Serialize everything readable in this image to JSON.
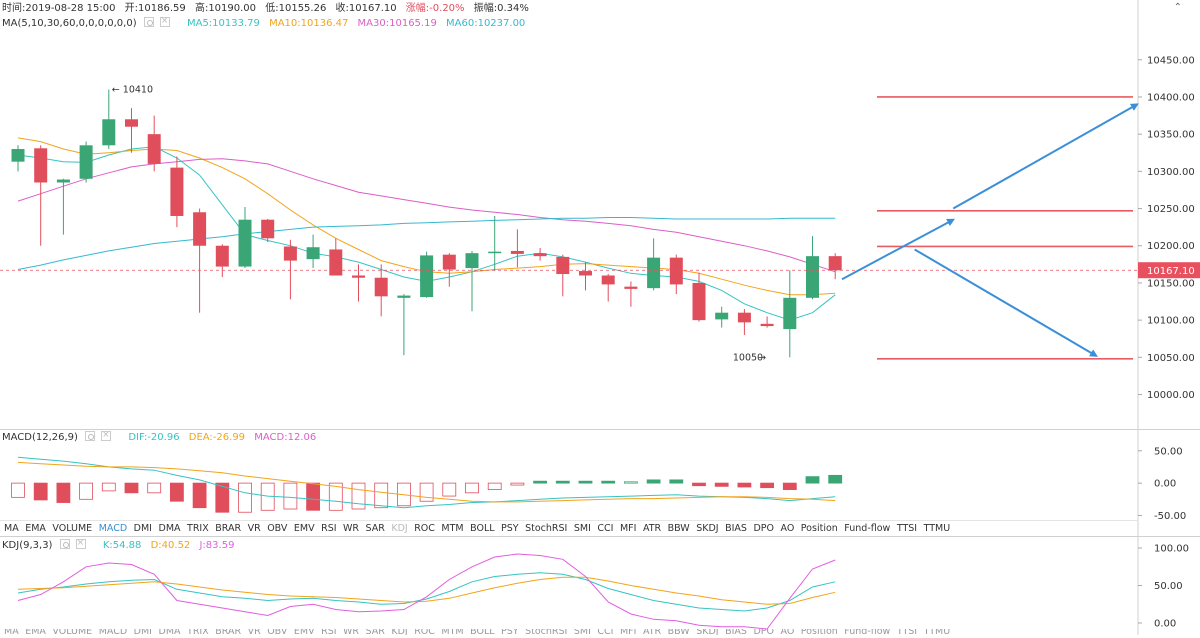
{
  "header": {
    "time": "时间:2019-08-28 15:00",
    "open": "开:10186.59",
    "high": "高:10190.00",
    "low": "低:10155.26",
    "close": "收:10167.10",
    "change": "涨幅:-0.20%",
    "amplitude": "振幅:0.34%"
  },
  "ma_header": {
    "label": "MA(5,10,30,60,0,0,0,0,0,0)",
    "ma5": "MA5:10133.79",
    "ma10": "MA10:10136.47",
    "ma30": "MA30:10165.19",
    "ma60": "MA60:10237.00"
  },
  "macd_header": {
    "label": "MACD(12,26,9)",
    "dif": "DIF:-20.96",
    "dea": "DEA:-26.99",
    "macd": "MACD:12.06"
  },
  "kdj_header": {
    "label": "KDJ(9,3,3)",
    "k": "K:54.88",
    "d": "D:40.52",
    "j": "J:83.59"
  },
  "indicator_tabs": [
    "MA",
    "EMA",
    "VOLUME",
    "MACD",
    "DMI",
    "DMA",
    "TRIX",
    "BRAR",
    "VR",
    "OBV",
    "EMV",
    "RSI",
    "WR",
    "SAR",
    "KDJ",
    "ROC",
    "MTM",
    "BOLL",
    "PSY",
    "StochRSI",
    "SMI",
    "CCI",
    "MFI",
    "ATR",
    "BBW",
    "SKDJ",
    "BIAS",
    "DPO",
    "AO",
    "Position",
    "Fund-flow",
    "TTSI",
    "TTMU"
  ],
  "indicator_tabs_dimmed": [
    "MA",
    "EMA",
    "VOLUME",
    "MACD",
    "DMI",
    "DMA",
    "TRIX",
    "BRAR",
    "VR",
    "OBV",
    "EMV",
    "RSI",
    "WR",
    "SAR",
    "KDJ",
    "ROC",
    "MTM",
    "BOLL",
    "PSY",
    "StochRSI",
    "SMI",
    "CCI",
    "MFI",
    "ATR",
    "BBW",
    "SKDJ",
    "BIAS",
    "DPO",
    "AO",
    "Position",
    "Fund-flow",
    "TTSI",
    "TTMU"
  ],
  "active_tab": "MACD",
  "disabled_tab": "KDJ",
  "colors": {
    "up": "#3aa575",
    "down": "#e04e5c",
    "ma5": "#36c3c4",
    "ma10": "#f2a41b",
    "ma30": "#dc5ec8",
    "ma60": "#36b9cf",
    "dif": "#36c3c4",
    "dea": "#f2a41b",
    "macd": "#dc5ec8",
    "k": "#36c3c4",
    "d": "#f2a41b",
    "j": "#e15ee0",
    "arrow": "#3b8fd8",
    "level": "#e85b62",
    "price_tag": "#e8505f"
  },
  "chart_data": [
    {
      "type": "candlestick",
      "title": "",
      "y_axis_ticks": [
        "10450.00",
        "10400.00",
        "10350.00",
        "10300.00",
        "10250.00",
        "10200.00",
        "10150.00",
        "10100.00",
        "10050.00",
        "10000.00"
      ],
      "tick_values": [
        10450,
        10400,
        10350,
        10300,
        10250,
        10200,
        10150,
        10100,
        10050,
        10000
      ],
      "ylim": [
        9955,
        10490
      ],
      "last_price_label": "10167.10",
      "last_price": 10167.1,
      "annotations": [
        {
          "text": "10410",
          "value": 10410,
          "candle_index": 4
        },
        {
          "text": "10050",
          "value": 10050,
          "candle_index": 33
        }
      ],
      "horizontal_levels": [
        10400,
        10247,
        10199,
        10048
      ],
      "trend_arrows": [
        {
          "from_candle": 36.3,
          "from_value": 10155,
          "to_candle": 41.2,
          "to_value": 10235
        },
        {
          "from_candle": 41.2,
          "from_value": 10250,
          "to_candle": 49.3,
          "to_value": 10390
        },
        {
          "from_candle": 39.5,
          "from_value": 10195,
          "to_candle": 47.5,
          "to_value": 10052
        }
      ],
      "candles": [
        {
          "o": 10313,
          "h": 10335,
          "l": 10300,
          "c": 10330
        },
        {
          "o": 10331,
          "h": 10335,
          "l": 10200,
          "c": 10285
        },
        {
          "o": 10285,
          "h": 10290,
          "l": 10215,
          "c": 10289
        },
        {
          "o": 10290,
          "h": 10340,
          "l": 10285,
          "c": 10335
        },
        {
          "o": 10335,
          "h": 10410,
          "l": 10330,
          "c": 10370
        },
        {
          "o": 10370,
          "h": 10385,
          "l": 10325,
          "c": 10360
        },
        {
          "o": 10350,
          "h": 10375,
          "l": 10300,
          "c": 10310
        },
        {
          "o": 10305,
          "h": 10320,
          "l": 10225,
          "c": 10240
        },
        {
          "o": 10245,
          "h": 10250,
          "l": 10110,
          "c": 10200
        },
        {
          "o": 10200,
          "h": 10202,
          "l": 10158,
          "c": 10172
        },
        {
          "o": 10172,
          "h": 10252,
          "l": 10170,
          "c": 10235
        },
        {
          "o": 10235,
          "h": 10236,
          "l": 10205,
          "c": 10210
        },
        {
          "o": 10199,
          "h": 10208,
          "l": 10128,
          "c": 10180
        },
        {
          "o": 10182,
          "h": 10215,
          "l": 10170,
          "c": 10198
        },
        {
          "o": 10195,
          "h": 10210,
          "l": 10160,
          "c": 10160
        },
        {
          "o": 10160,
          "h": 10175,
          "l": 10125,
          "c": 10157
        },
        {
          "o": 10157,
          "h": 10175,
          "l": 10105,
          "c": 10132
        },
        {
          "o": 10130,
          "h": 10135,
          "l": 10053,
          "c": 10133
        },
        {
          "o": 10131,
          "h": 10192,
          "l": 10130,
          "c": 10187
        },
        {
          "o": 10188,
          "h": 10190,
          "l": 10145,
          "c": 10168
        },
        {
          "o": 10170,
          "h": 10193,
          "l": 10112,
          "c": 10190
        },
        {
          "o": 10190,
          "h": 10240,
          "l": 10166,
          "c": 10192
        },
        {
          "o": 10193,
          "h": 10222,
          "l": 10171,
          "c": 10189
        },
        {
          "o": 10190,
          "h": 10197,
          "l": 10180,
          "c": 10186
        },
        {
          "o": 10185,
          "h": 10188,
          "l": 10132,
          "c": 10162
        },
        {
          "o": 10166,
          "h": 10178,
          "l": 10140,
          "c": 10160
        },
        {
          "o": 10160,
          "h": 10162,
          "l": 10125,
          "c": 10148
        },
        {
          "o": 10145,
          "h": 10152,
          "l": 10118,
          "c": 10142
        },
        {
          "o": 10143,
          "h": 10210,
          "l": 10140,
          "c": 10184
        },
        {
          "o": 10184,
          "h": 10188,
          "l": 10135,
          "c": 10148
        },
        {
          "o": 10150,
          "h": 10164,
          "l": 10098,
          "c": 10100
        },
        {
          "o": 10101,
          "h": 10118,
          "l": 10090,
          "c": 10110
        },
        {
          "o": 10110,
          "h": 10115,
          "l": 10080,
          "c": 10097
        },
        {
          "o": 10095,
          "h": 10105,
          "l": 10090,
          "c": 10092
        },
        {
          "o": 10088,
          "h": 10167,
          "l": 10050,
          "c": 10130
        },
        {
          "o": 10130,
          "h": 10213,
          "l": 10128,
          "c": 10186
        },
        {
          "o": 10186,
          "h": 10190,
          "l": 10155,
          "c": 10167
        }
      ],
      "series": [
        {
          "name": "MA5",
          "values": [
            10322,
            10318,
            10313,
            10312,
            10322,
            10330,
            10333,
            10318,
            10295,
            10255,
            10215,
            10207,
            10200,
            10190,
            10185,
            10178,
            10168,
            10158,
            10152,
            10158,
            10165,
            10175,
            10186,
            10190,
            10185,
            10178,
            10170,
            10163,
            10160,
            10158,
            10152,
            10140,
            10122,
            10110,
            10100,
            10110,
            10134
          ]
        },
        {
          "name": "MA10",
          "values": [
            10345,
            10340,
            10330,
            10323,
            10325,
            10328,
            10330,
            10328,
            10318,
            10305,
            10290,
            10270,
            10248,
            10228,
            10210,
            10195,
            10180,
            10172,
            10165,
            10163,
            10165,
            10168,
            10170,
            10172,
            10175,
            10176,
            10174,
            10172,
            10170,
            10168,
            10163,
            10155,
            10147,
            10140,
            10134,
            10134,
            10136
          ]
        },
        {
          "name": "MA30",
          "values": [
            10260,
            10270,
            10280,
            10290,
            10298,
            10306,
            10310,
            10313,
            10316,
            10317,
            10314,
            10310,
            10300,
            10290,
            10281,
            10272,
            10267,
            10262,
            10257,
            10252,
            10248,
            10245,
            10242,
            10238,
            10235,
            10233,
            10230,
            10227,
            10222,
            10218,
            10212,
            10206,
            10200,
            10193,
            10185,
            10175,
            10165
          ]
        },
        {
          "name": "MA60",
          "values": [
            10168,
            10174,
            10181,
            10187,
            10193,
            10198,
            10203,
            10206,
            10209,
            10212,
            10216,
            10219,
            10222,
            10225,
            10226,
            10227,
            10228,
            10230,
            10231,
            10232,
            10233,
            10234,
            10235,
            10236,
            10237,
            10237,
            10238,
            10238,
            10237,
            10236,
            10236,
            10236,
            10236,
            10236,
            10237,
            10237,
            10237
          ]
        }
      ]
    },
    {
      "type": "bar",
      "title": "MACD",
      "y_axis_ticks": [
        "50.00",
        "0.00",
        "-50.00"
      ],
      "tick_values": [
        50,
        0,
        -50
      ],
      "ylim": [
        -57,
        62
      ],
      "histogram": [
        -22,
        -26,
        -30,
        -25,
        -12,
        -15,
        -15,
        -28,
        -38,
        -45,
        -45,
        -42,
        -40,
        -42,
        -42,
        -40,
        -38,
        -35,
        -28,
        -20,
        -15,
        -10,
        -3,
        3,
        3,
        3,
        3,
        2,
        5,
        5,
        -4,
        -5,
        -6,
        -7,
        -10,
        10,
        12
      ],
      "series": [
        {
          "name": "DIF",
          "values": [
            40,
            37,
            34,
            30,
            25,
            22,
            20,
            12,
            5,
            -5,
            -15,
            -20,
            -22,
            -25,
            -28,
            -32,
            -35,
            -38,
            -35,
            -33,
            -30,
            -29,
            -27,
            -25,
            -23,
            -22,
            -21,
            -20,
            -19,
            -18,
            -20,
            -21,
            -22,
            -24,
            -27,
            -24,
            -21
          ]
        },
        {
          "name": "DEA",
          "values": [
            32,
            30,
            28,
            26,
            25,
            25,
            24,
            22,
            19,
            16,
            11,
            7,
            3,
            -1,
            -5,
            -10,
            -14,
            -18,
            -22,
            -25,
            -28,
            -29,
            -29,
            -28,
            -27,
            -26,
            -25,
            -24,
            -24,
            -23,
            -22,
            -21,
            -21,
            -22,
            -24,
            -25,
            -27
          ]
        }
      ]
    },
    {
      "type": "line",
      "title": "KDJ",
      "y_axis_ticks": [
        "100.00",
        "50.00",
        "0.00"
      ],
      "tick_values": [
        100,
        50,
        0
      ],
      "ylim": [
        -8,
        104
      ],
      "series": [
        {
          "name": "K",
          "values": [
            40,
            45,
            48,
            52,
            55,
            57,
            58,
            45,
            40,
            35,
            33,
            30,
            32,
            33,
            30,
            28,
            25,
            26,
            32,
            42,
            55,
            62,
            65,
            67,
            65,
            58,
            46,
            38,
            30,
            25,
            20,
            18,
            16,
            20,
            30,
            48,
            55
          ]
        },
        {
          "name": "D",
          "values": [
            45,
            46,
            47,
            49,
            51,
            53,
            55,
            52,
            48,
            44,
            41,
            38,
            36,
            35,
            34,
            32,
            30,
            28,
            29,
            33,
            40,
            47,
            53,
            58,
            61,
            61,
            56,
            50,
            45,
            40,
            36,
            31,
            28,
            25,
            26,
            34,
            41
          ]
        },
        {
          "name": "J",
          "values": [
            30,
            38,
            55,
            75,
            80,
            78,
            65,
            30,
            25,
            20,
            15,
            10,
            22,
            25,
            18,
            15,
            16,
            18,
            35,
            58,
            75,
            88,
            92,
            90,
            85,
            62,
            28,
            12,
            5,
            3,
            -3,
            -5,
            -5,
            -8,
            33,
            72,
            84
          ]
        }
      ]
    }
  ]
}
